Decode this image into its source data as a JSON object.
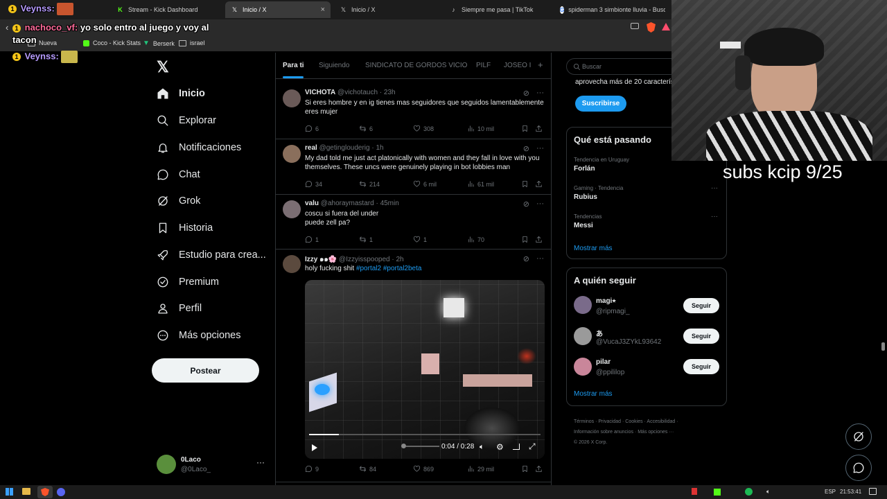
{
  "browser": {
    "tabs": [
      {
        "label": "Stream - Kick Dashboard",
        "icon": "kick-icon"
      },
      {
        "label": "Inicio / X",
        "icon": "x-icon",
        "active": true
      },
      {
        "label": "Inicio / X",
        "icon": "x-icon"
      },
      {
        "label": "Siempre me pasa | TikTok",
        "icon": "tiktok-icon"
      },
      {
        "label": "spiderman 3 simbionte lluvia - Busc",
        "icon": "google-icon"
      }
    ],
    "bookmarks": [
      {
        "label": "Nueva"
      },
      {
        "label": "Coco - Kick Stats"
      },
      {
        "label": "Berserk"
      },
      {
        "label": "israel"
      }
    ]
  },
  "chat_overlay": [
    {
      "user": "Veynss:",
      "message": ""
    },
    {
      "user": "nachoco_vf:",
      "message": "yo solo entro al juego y voy al tacon"
    },
    {
      "user": "Veynss:",
      "message": ""
    }
  ],
  "stream_overlay": {
    "subs_text": "subs kcip 9/25"
  },
  "nav": {
    "items": [
      {
        "label": "Inicio",
        "icon": "home-icon"
      },
      {
        "label": "Explorar",
        "icon": "search-icon"
      },
      {
        "label": "Notificaciones",
        "icon": "bell-icon"
      },
      {
        "label": "Chat",
        "icon": "chat-icon"
      },
      {
        "label": "Grok",
        "icon": "grok-icon"
      },
      {
        "label": "Historia",
        "icon": "bookmark-icon"
      },
      {
        "label": "Estudio para crea...",
        "icon": "rocket-icon"
      },
      {
        "label": "Premium",
        "icon": "verified-icon"
      },
      {
        "label": "Perfil",
        "icon": "person-icon"
      },
      {
        "label": "Más opciones",
        "icon": "more-circle-icon"
      }
    ],
    "post_label": "Postear",
    "account": {
      "name": "0Laco",
      "handle": "@0Laco_"
    }
  },
  "timeline": {
    "tabs": [
      "Para ti",
      "Siguiendo",
      "SINDICATO DE GORDOS VICIO",
      "PILF",
      "JOSEO I"
    ],
    "tweets": [
      {
        "name": "VICHOTA",
        "handle": "@vichotauch",
        "time": "23h",
        "text": "Si eres hombre y en ig tienes mas seguidores que seguidos lamentablemente eres mujer",
        "replies": "6",
        "reposts": "6",
        "likes": "308",
        "views": "10 mil"
      },
      {
        "name": "real",
        "handle": "@getinglouderig",
        "time": "1h",
        "text": "My dad told me just act platonically with women and they fall in love with you themselves. These uncs were genuinely playing in bot lobbies man",
        "replies": "34",
        "reposts": "214",
        "likes": "6 mil",
        "views": "61 mil"
      },
      {
        "name": "valu",
        "handle": "@ahoraymastard",
        "time": "45min",
        "text_line1": "coscu si fuera del under",
        "text_line2": "puede zell pa?",
        "replies": "1",
        "reposts": "1",
        "likes": "1",
        "views": "70"
      },
      {
        "name": "Izzy ๑๑🌸",
        "handle": "@Izzyisspooped",
        "time": "2h",
        "text": "holy fucking shit",
        "tags": "#portal2 #portal2beta",
        "video_time": "0:04 / 0:28",
        "replies": "9",
        "reposts": "84",
        "likes": "869",
        "views": "29 mil"
      }
    ]
  },
  "sidebar": {
    "search_placeholder": "Buscar",
    "premium_text": "aprovecha más de 20 caracterís",
    "subscribe_label": "Suscribirse",
    "trends_title": "Qué está pasando",
    "trends": [
      {
        "meta": "Tendencia en Uruguay",
        "name": "Forlán"
      },
      {
        "meta": "Gaming · Tendencia",
        "name": "Rubius"
      },
      {
        "meta": "Tendencias",
        "name": "Messi"
      }
    ],
    "show_more": "Mostrar más",
    "follow_title": "A quién seguir",
    "follow": [
      {
        "name": "magi⭑",
        "handle": "@ripmagi_"
      },
      {
        "name": "あ",
        "handle": "@VucaJ3ZYkL93642"
      },
      {
        "name": "pilar",
        "handle": "@ppililop"
      }
    ],
    "follow_label": "Seguir",
    "footer_line1": "Términos · Privacidad · Cookies · Accesibilidad ·",
    "footer_line2": "Información sobre anuncios · Más opciones ···",
    "footer_line3": "© 2026 X Corp."
  },
  "taskbar": {
    "lang": "ESP",
    "clock": "21:53:41"
  }
}
